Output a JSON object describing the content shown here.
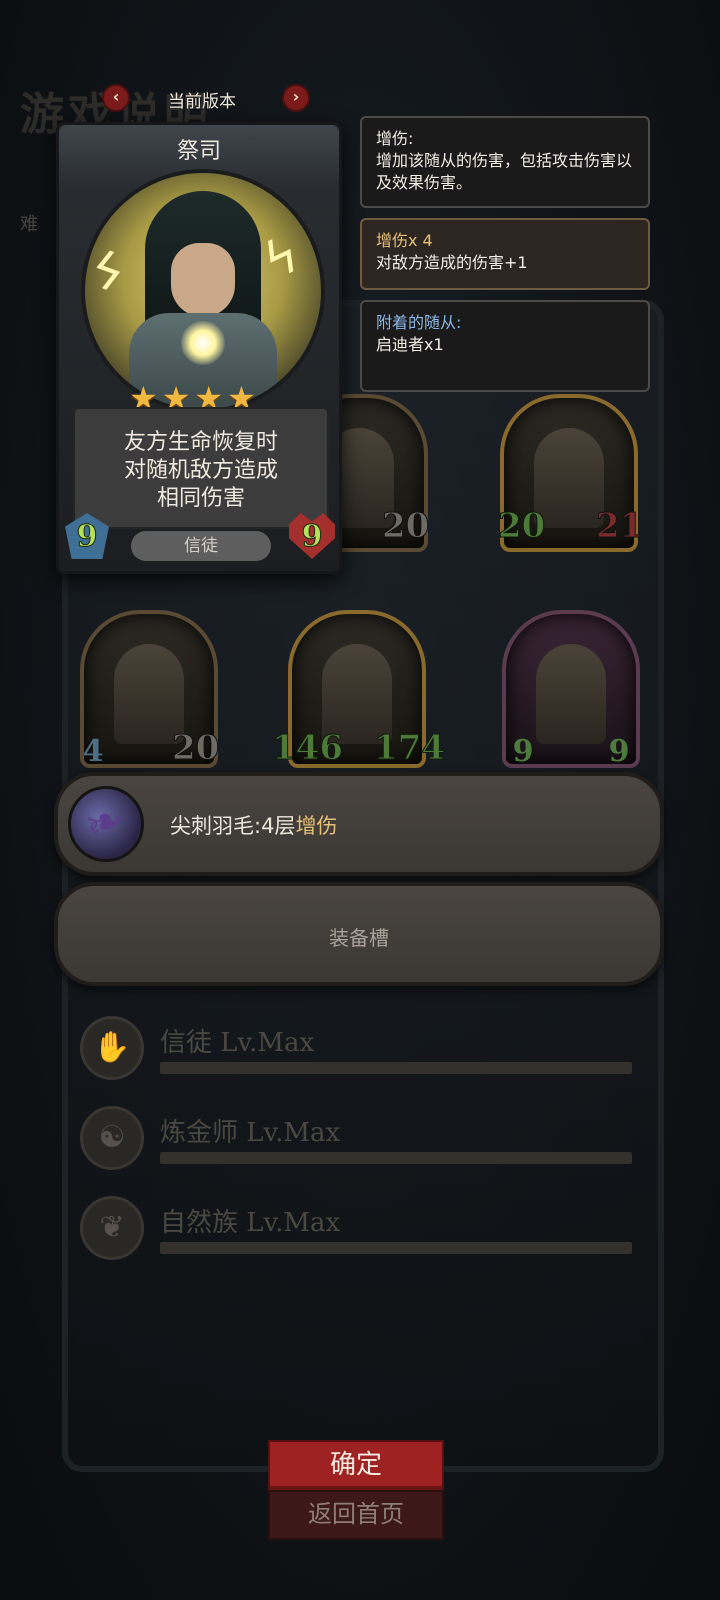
{
  "background": {
    "title_fragment": "游戏说明",
    "difficulty_fragment": "难"
  },
  "version": {
    "label": "当前版本"
  },
  "card": {
    "name": "祭司",
    "stars": 4,
    "text_lines": [
      "友方生命恢复时",
      "对随机敌方造成",
      "相同伤害"
    ],
    "attack": "9",
    "health": "9",
    "tribe": "信徒"
  },
  "tooltips": [
    {
      "head": "增伤:",
      "body": "增加该随从的伤害，包括攻击伤害以及效果伤害。"
    },
    {
      "head": "增伤x 4",
      "body": "对敌方造成的伤害+1"
    },
    {
      "head": "附着的随从:",
      "body": "启迪者x1"
    }
  ],
  "minions_row1": [
    {
      "atk": "",
      "hp": "20"
    },
    {
      "atk": "20",
      "hp": "21"
    }
  ],
  "minions_row2": [
    {
      "atk": "4",
      "hp": "20"
    },
    {
      "atk": "146",
      "hp": "174"
    },
    {
      "atk": "9",
      "hp": "9"
    }
  ],
  "equipment": {
    "item_prefix": "尖刺羽毛:4层",
    "item_highlight": "增伤",
    "slot_label": "装备槽"
  },
  "tribes": [
    {
      "icon": "praying-hands-icon",
      "label": "信徒 Lv.Max"
    },
    {
      "icon": "swirl-icon",
      "label": "炼金师 Lv.Max"
    },
    {
      "icon": "leaf-icon",
      "label": "自然族 Lv.Max"
    }
  ],
  "buttons": {
    "confirm": "确定",
    "home": "返回首页"
  },
  "colors": {
    "accent_red": "#9e2222",
    "highlight_gold": "#e6c278",
    "link_blue": "#8bb6e6"
  }
}
